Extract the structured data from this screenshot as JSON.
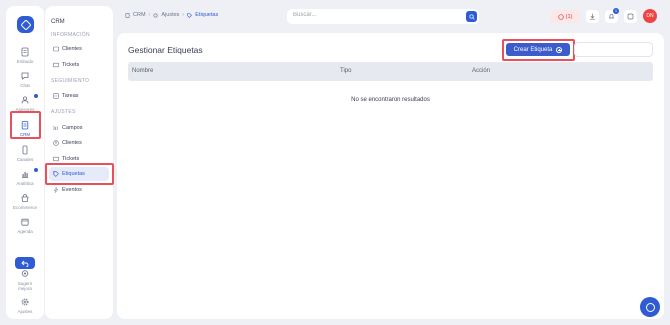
{
  "rail": {
    "items": [
      {
        "label": "Embudo",
        "icon": "funnel-icon"
      },
      {
        "label": "Chat",
        "icon": "chat-icon"
      },
      {
        "label": "Asesores",
        "icon": "users-icon"
      },
      {
        "label": "CRM",
        "icon": "clipboard-icon"
      },
      {
        "label": "Canales",
        "icon": "phone-icon"
      },
      {
        "label": "Analítica",
        "icon": "bar-chart-icon"
      },
      {
        "label": "Ecommerce",
        "icon": "store-icon"
      },
      {
        "label": "Agenda",
        "icon": "calendar-icon"
      },
      {
        "label": "Sugerir mejora",
        "icon": "lightbulb-icon"
      },
      {
        "label": "Ajustes",
        "icon": "gear-icon"
      }
    ]
  },
  "menu": {
    "title": "CRM",
    "sections": [
      {
        "label": "INFORMACIÓN",
        "items": [
          {
            "label": "Clientes"
          },
          {
            "label": "Tickets"
          }
        ]
      },
      {
        "label": "SEGUIMIENTO",
        "items": [
          {
            "label": "Tareas"
          }
        ]
      },
      {
        "label": "AJUSTES",
        "items": [
          {
            "label": "Campos"
          },
          {
            "label": "Clientes"
          },
          {
            "label": "Tickets"
          },
          {
            "label": "Etiquetas"
          },
          {
            "label": "Eventos"
          }
        ]
      }
    ]
  },
  "topbar": {
    "breadcrumb": [
      "CRM",
      "Ajustes",
      "Etiquetas"
    ],
    "search_placeholder": "Buscar...",
    "whatsapp_count": "(1)",
    "notification_count": "1",
    "avatar_initials": "DN"
  },
  "main": {
    "title": "Gestionar Etiquetas",
    "create_button": "Crear Etiqueta",
    "columns": [
      "Nombre",
      "Tipo",
      "Acción"
    ],
    "empty_message": "No se encontraron resultados"
  },
  "colors": {
    "accent": "#2f5bd3",
    "highlight": "#e8505b",
    "background": "#eef0f5"
  }
}
